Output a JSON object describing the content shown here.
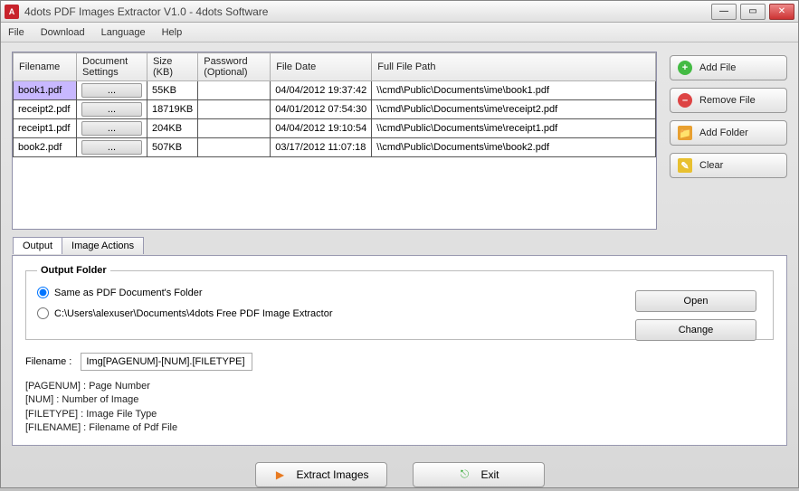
{
  "window": {
    "title": "4dots PDF Images Extractor V1.0 - 4dots Software"
  },
  "menu": {
    "file": "File",
    "download": "Download",
    "language": "Language",
    "help": "Help"
  },
  "columns": {
    "filename": "Filename",
    "docSettings": "Document Settings",
    "size": "Size (KB)",
    "password": "Password (Optional)",
    "filedate": "File Date",
    "fullpath": "Full File Path"
  },
  "rows": [
    {
      "filename": "book1.pdf",
      "settings": "...",
      "size": "55KB",
      "password": "",
      "date": "04/04/2012 19:37:42",
      "path": "\\\\cmd\\Public\\Documents\\ime\\book1.pdf"
    },
    {
      "filename": "receipt2.pdf",
      "settings": "...",
      "size": "18719KB",
      "password": "",
      "date": "04/01/2012 07:54:30",
      "path": "\\\\cmd\\Public\\Documents\\ime\\receipt2.pdf"
    },
    {
      "filename": "receipt1.pdf",
      "settings": "...",
      "size": "204KB",
      "password": "",
      "date": "04/04/2012 19:10:54",
      "path": "\\\\cmd\\Public\\Documents\\ime\\receipt1.pdf"
    },
    {
      "filename": "book2.pdf",
      "settings": "...",
      "size": "507KB",
      "password": "",
      "date": "03/17/2012 11:07:18",
      "path": "\\\\cmd\\Public\\Documents\\ime\\book2.pdf"
    }
  ],
  "sidebar": {
    "add": "Add File",
    "remove": "Remove File",
    "folder": "Add Folder",
    "clear": "Clear"
  },
  "tabs": {
    "output": "Output",
    "imageActions": "Image Actions"
  },
  "outputFolder": {
    "legend": "Output Folder",
    "same": "Same as PDF Document's Folder",
    "custom": "C:\\Users\\alexuser\\Documents\\4dots Free PDF Image Extractor",
    "open": "Open",
    "change": "Change"
  },
  "filenameSection": {
    "label": "Filename :",
    "value": "Img[PAGENUM]-[NUM].[FILETYPE]",
    "hints": "[PAGENUM] : Page Number\n[NUM] : Number of Image\n[FILETYPE] : Image File Type\n[FILENAME] : Filename of Pdf File"
  },
  "bottom": {
    "extract": "Extract Images",
    "exit": "Exit"
  }
}
